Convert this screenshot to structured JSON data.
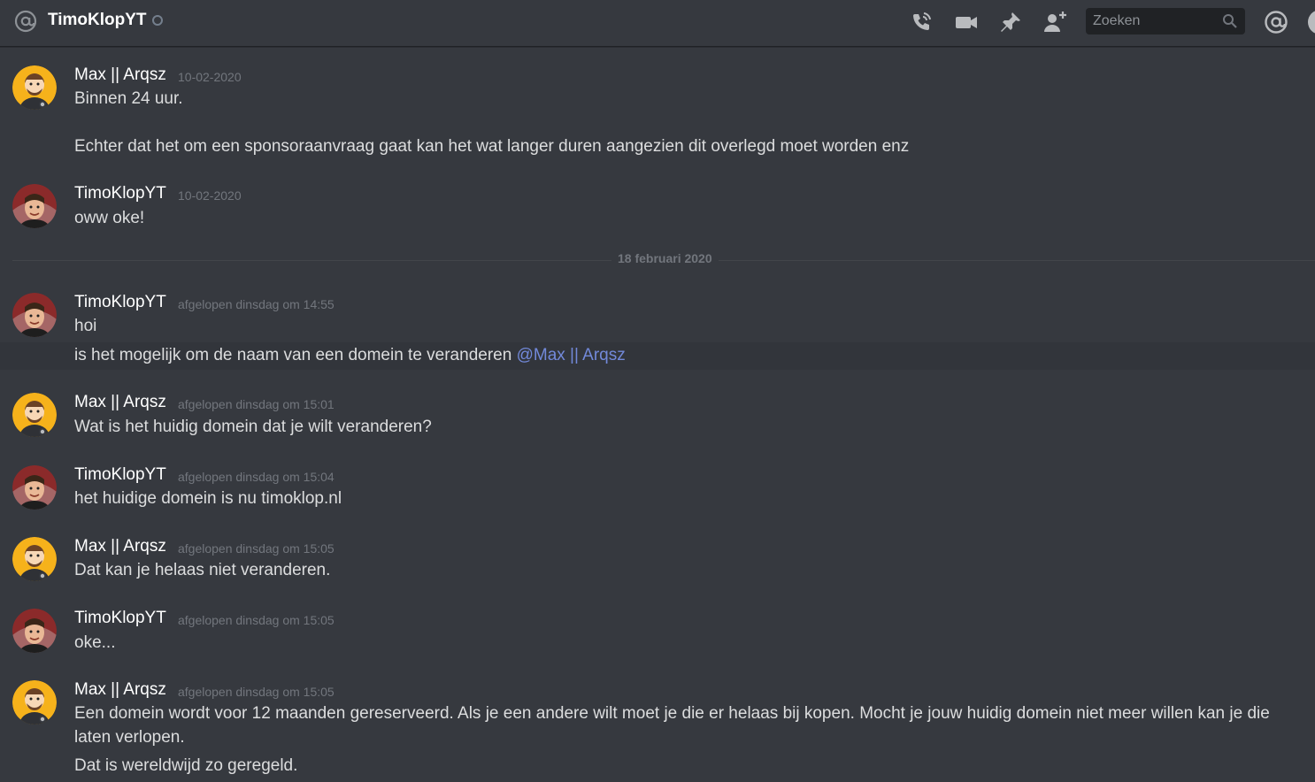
{
  "header": {
    "channel_name": "TimoKlopYT",
    "search_placeholder": "Zoeken",
    "icons": [
      "at-icon",
      "call-icon",
      "video-icon",
      "pin-icon",
      "add-friend-icon",
      "search-icon",
      "mentions-icon"
    ]
  },
  "colors": {
    "background": "#36393f",
    "header_border": "#202225",
    "username": "#ffffff",
    "text": "#dcddde",
    "timestamp": "#72767d",
    "mention": "#7289da",
    "avatar_max_bg": "#f6b21b",
    "avatar_timo_bg": "#8b2a2a"
  },
  "messages": [
    {
      "author": "Max || Arqsz",
      "timestamp": "10-02-2020",
      "avatar": "max-avatar",
      "lines": [
        "Binnen 24 uur.",
        "Echter dat het om een sponsoraanvraag gaat kan het wat langer duren aangezien dit overlegd moet worden enz"
      ]
    },
    {
      "author": "TimoKlopYT",
      "timestamp": "10-02-2020",
      "avatar": "timo-avatar",
      "lines": [
        "oww oke!"
      ]
    },
    {
      "author": "TimoKlopYT",
      "timestamp": "afgelopen dinsdag om 14:55",
      "avatar": "timo-avatar",
      "lines": [
        "hoi",
        "is het mogelijk om de naam van een domein te veranderen "
      ],
      "mention": "@Max || Arqsz"
    },
    {
      "author": "Max || Arqsz",
      "timestamp": "afgelopen dinsdag om 15:01",
      "avatar": "max-avatar",
      "lines": [
        "Wat is het huidig domein dat je wilt veranderen?"
      ]
    },
    {
      "author": "TimoKlopYT",
      "timestamp": "afgelopen dinsdag om 15:04",
      "avatar": "timo-avatar",
      "lines": [
        "het huidige domein is nu timoklop.nl"
      ]
    },
    {
      "author": "Max || Arqsz",
      "timestamp": "afgelopen dinsdag om 15:05",
      "avatar": "max-avatar",
      "lines": [
        "Dat kan je helaas niet veranderen."
      ]
    },
    {
      "author": "TimoKlopYT",
      "timestamp": "afgelopen dinsdag om 15:05",
      "avatar": "timo-avatar",
      "lines": [
        "oke..."
      ]
    },
    {
      "author": "Max || Arqsz",
      "timestamp": "afgelopen dinsdag om 15:05",
      "avatar": "max-avatar",
      "lines": [
        "Een domein wordt voor 12 maanden gereserveerd. Als je een andere wilt moet je die er helaas bij kopen. Mocht je jouw huidig domein niet meer willen kan je die laten verlopen.",
        "Dat is wereldwijd zo geregeld."
      ]
    }
  ],
  "date_divider": "18 februari 2020"
}
